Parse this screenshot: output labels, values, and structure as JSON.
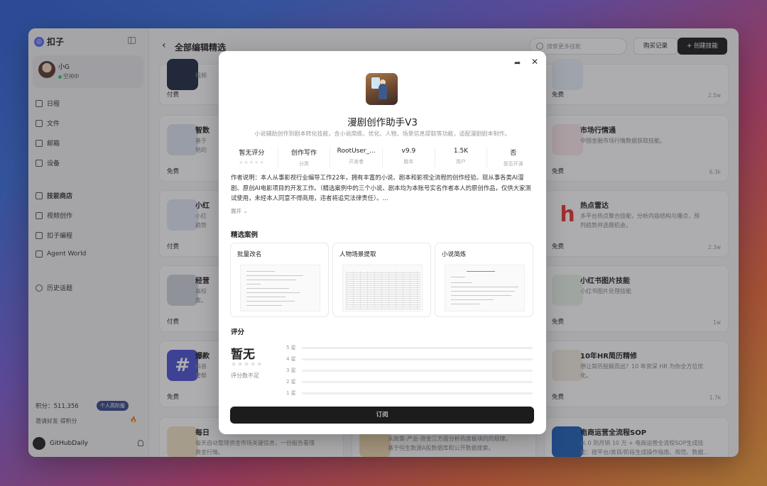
{
  "app": {
    "logo": "扣子"
  },
  "user": {
    "name": "小G",
    "status": "空闲中"
  },
  "sidebar": {
    "items": [
      {
        "label": "日程"
      },
      {
        "label": "文件"
      },
      {
        "label": "邮箱"
      },
      {
        "label": "设备"
      },
      {
        "label": "技能商店"
      },
      {
        "label": "视频创作"
      },
      {
        "label": "扣子编程"
      },
      {
        "label": "Agent World"
      },
      {
        "label": "历史话题"
      }
    ],
    "score": "积分：511,356",
    "badge": "个人高阶版",
    "invite": "邀请好友 得积分",
    "account": "GitHubDaily"
  },
  "header": {
    "title": "全部编辑精选",
    "search_placeholder": "搜索更多技能",
    "buy_records": "购买记录",
    "create": "创建技能"
  },
  "cards": [
    {
      "title": "",
      "desc": "视频",
      "price": "付费",
      "count": ""
    },
    {
      "title": "",
      "desc": "",
      "price": "免费",
      "count": "2.5w"
    },
    {
      "title": "智数",
      "desc": "基于\n地的",
      "price": "免费",
      "count": ""
    },
    {
      "title": "市场行情通",
      "desc": "中国金融市场行情数据获取技能。",
      "price": "免费",
      "count": "6.3k"
    },
    {
      "title": "小红",
      "desc": "小红\n趋势",
      "price": "付费",
      "count": ""
    },
    {
      "title": "热点雷达",
      "desc": "多平台热点聚合技能，分析内容结构与爆点，预\n判趋势并选题机会。",
      "price": "免费",
      "count": "2.3w"
    },
    {
      "title": "经营",
      "desc": "高校\n库。",
      "price": "付费",
      "count": ""
    },
    {
      "title": "小红书图片技能",
      "desc": "小红书图片处理技能",
      "price": "免费",
      "count": "1w"
    },
    {
      "title": "爆款",
      "desc": "抖音\n管帮",
      "price": "免费",
      "count": ""
    },
    {
      "title": "10年HR简历精修",
      "desc": "想让简历脱颖而出？10 年资深 HR 为你全方位优\n化。",
      "price": "免费",
      "count": "1.7k"
    },
    {
      "title": "每日",
      "desc": "每天自动整理资金市场关键信息，一份报告看懂\n资金行情。",
      "price": "",
      "count": ""
    },
    {
      "title": "",
      "desc": "从政策-产业-资金三方面分析热度板块的的规律。\n基于恒生数源A股数据库和公开数据搜索。",
      "price": "",
      "count": ""
    },
    {
      "title": "电商运营全流程SOP",
      "desc": "从 0 到月销 10 万 + 电商运营全流程SOP生成技\n能：按平台/类目/阶段生成操作指南、规范、数据...",
      "price": "",
      "count": ""
    }
  ],
  "modal": {
    "title": "漫剧创作助手V3",
    "subtitle": "小说辅助创作到剧本转化技能，含小说简练、优化、人物、场景信息提取等功能，适配漫剧剧本制作。",
    "stats": [
      {
        "value": "暂无评分",
        "label": ""
      },
      {
        "value": "创作写作",
        "label": "分类"
      },
      {
        "value": "RootUser_...",
        "label": "开发者"
      },
      {
        "value": "v9.9",
        "label": "版本"
      },
      {
        "value": "1.5K",
        "label": "用户"
      },
      {
        "value": "否",
        "label": "是否开源"
      }
    ],
    "description": "作者说明：本人从事影视行业编导工作22年，拥有丰富的小说、剧本和影视全流程的创作经验。现从事各类AI漫剧、原创AI电影项目的开发工作。（精选案例中的三个小说、剧本均为本账号实名作者本人的原创作品，仅供大家测试使用，未经本人同意不得商用，违者将追究法律责任）。...",
    "expand": "展开 ⌄",
    "cases_title": "精选案例",
    "cases": [
      {
        "label": "批量改名"
      },
      {
        "label": "人物场景提取"
      },
      {
        "label": "小说简炼"
      }
    ],
    "rating_title": "评分",
    "rating_big": "暂无",
    "rating_note": "评分数不足",
    "rating_rows": [
      {
        "label": "5 星",
        "value": 0
      },
      {
        "label": "4 星",
        "value": 0
      },
      {
        "label": "3 星",
        "value": 0
      },
      {
        "label": "2 星",
        "value": 0
      },
      {
        "label": "1 星",
        "value": 0
      }
    ],
    "subscribe": "订阅"
  },
  "colors": {
    "accent": "#1c1c1e",
    "brand": "#5b6cf0"
  }
}
